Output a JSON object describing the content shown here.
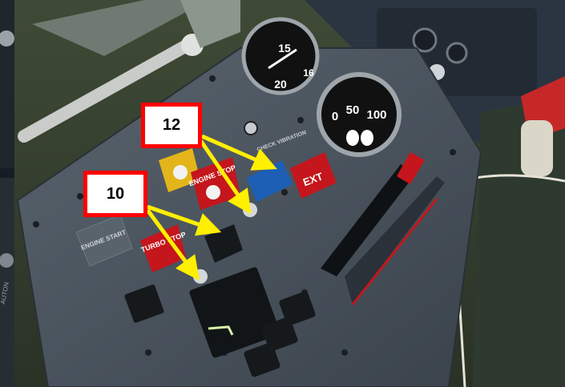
{
  "callouts": [
    {
      "label": "12"
    },
    {
      "label": "10"
    }
  ],
  "panel_labels": {
    "engine_stop": "ENGINE STOP",
    "turbo_stop": "TURBO STOP",
    "check_vibration": "CHECK VIBRATION",
    "engine_start": "ENGINE START",
    "ext": "EXT",
    "oxygen_gauge_digits": [
      "15",
      "20",
      "16"
    ],
    "flow_gauge_digits": [
      "0",
      "50",
      "100"
    ],
    "side_panel_text": "AUTON"
  },
  "colors": {
    "callout_border": "#ff0000",
    "arrow": "#ffef00",
    "panel": "#4c5660",
    "guard_yellow": "#e3b51a",
    "guard_red": "#c4161c",
    "guard_blue": "#1c5fb5"
  }
}
